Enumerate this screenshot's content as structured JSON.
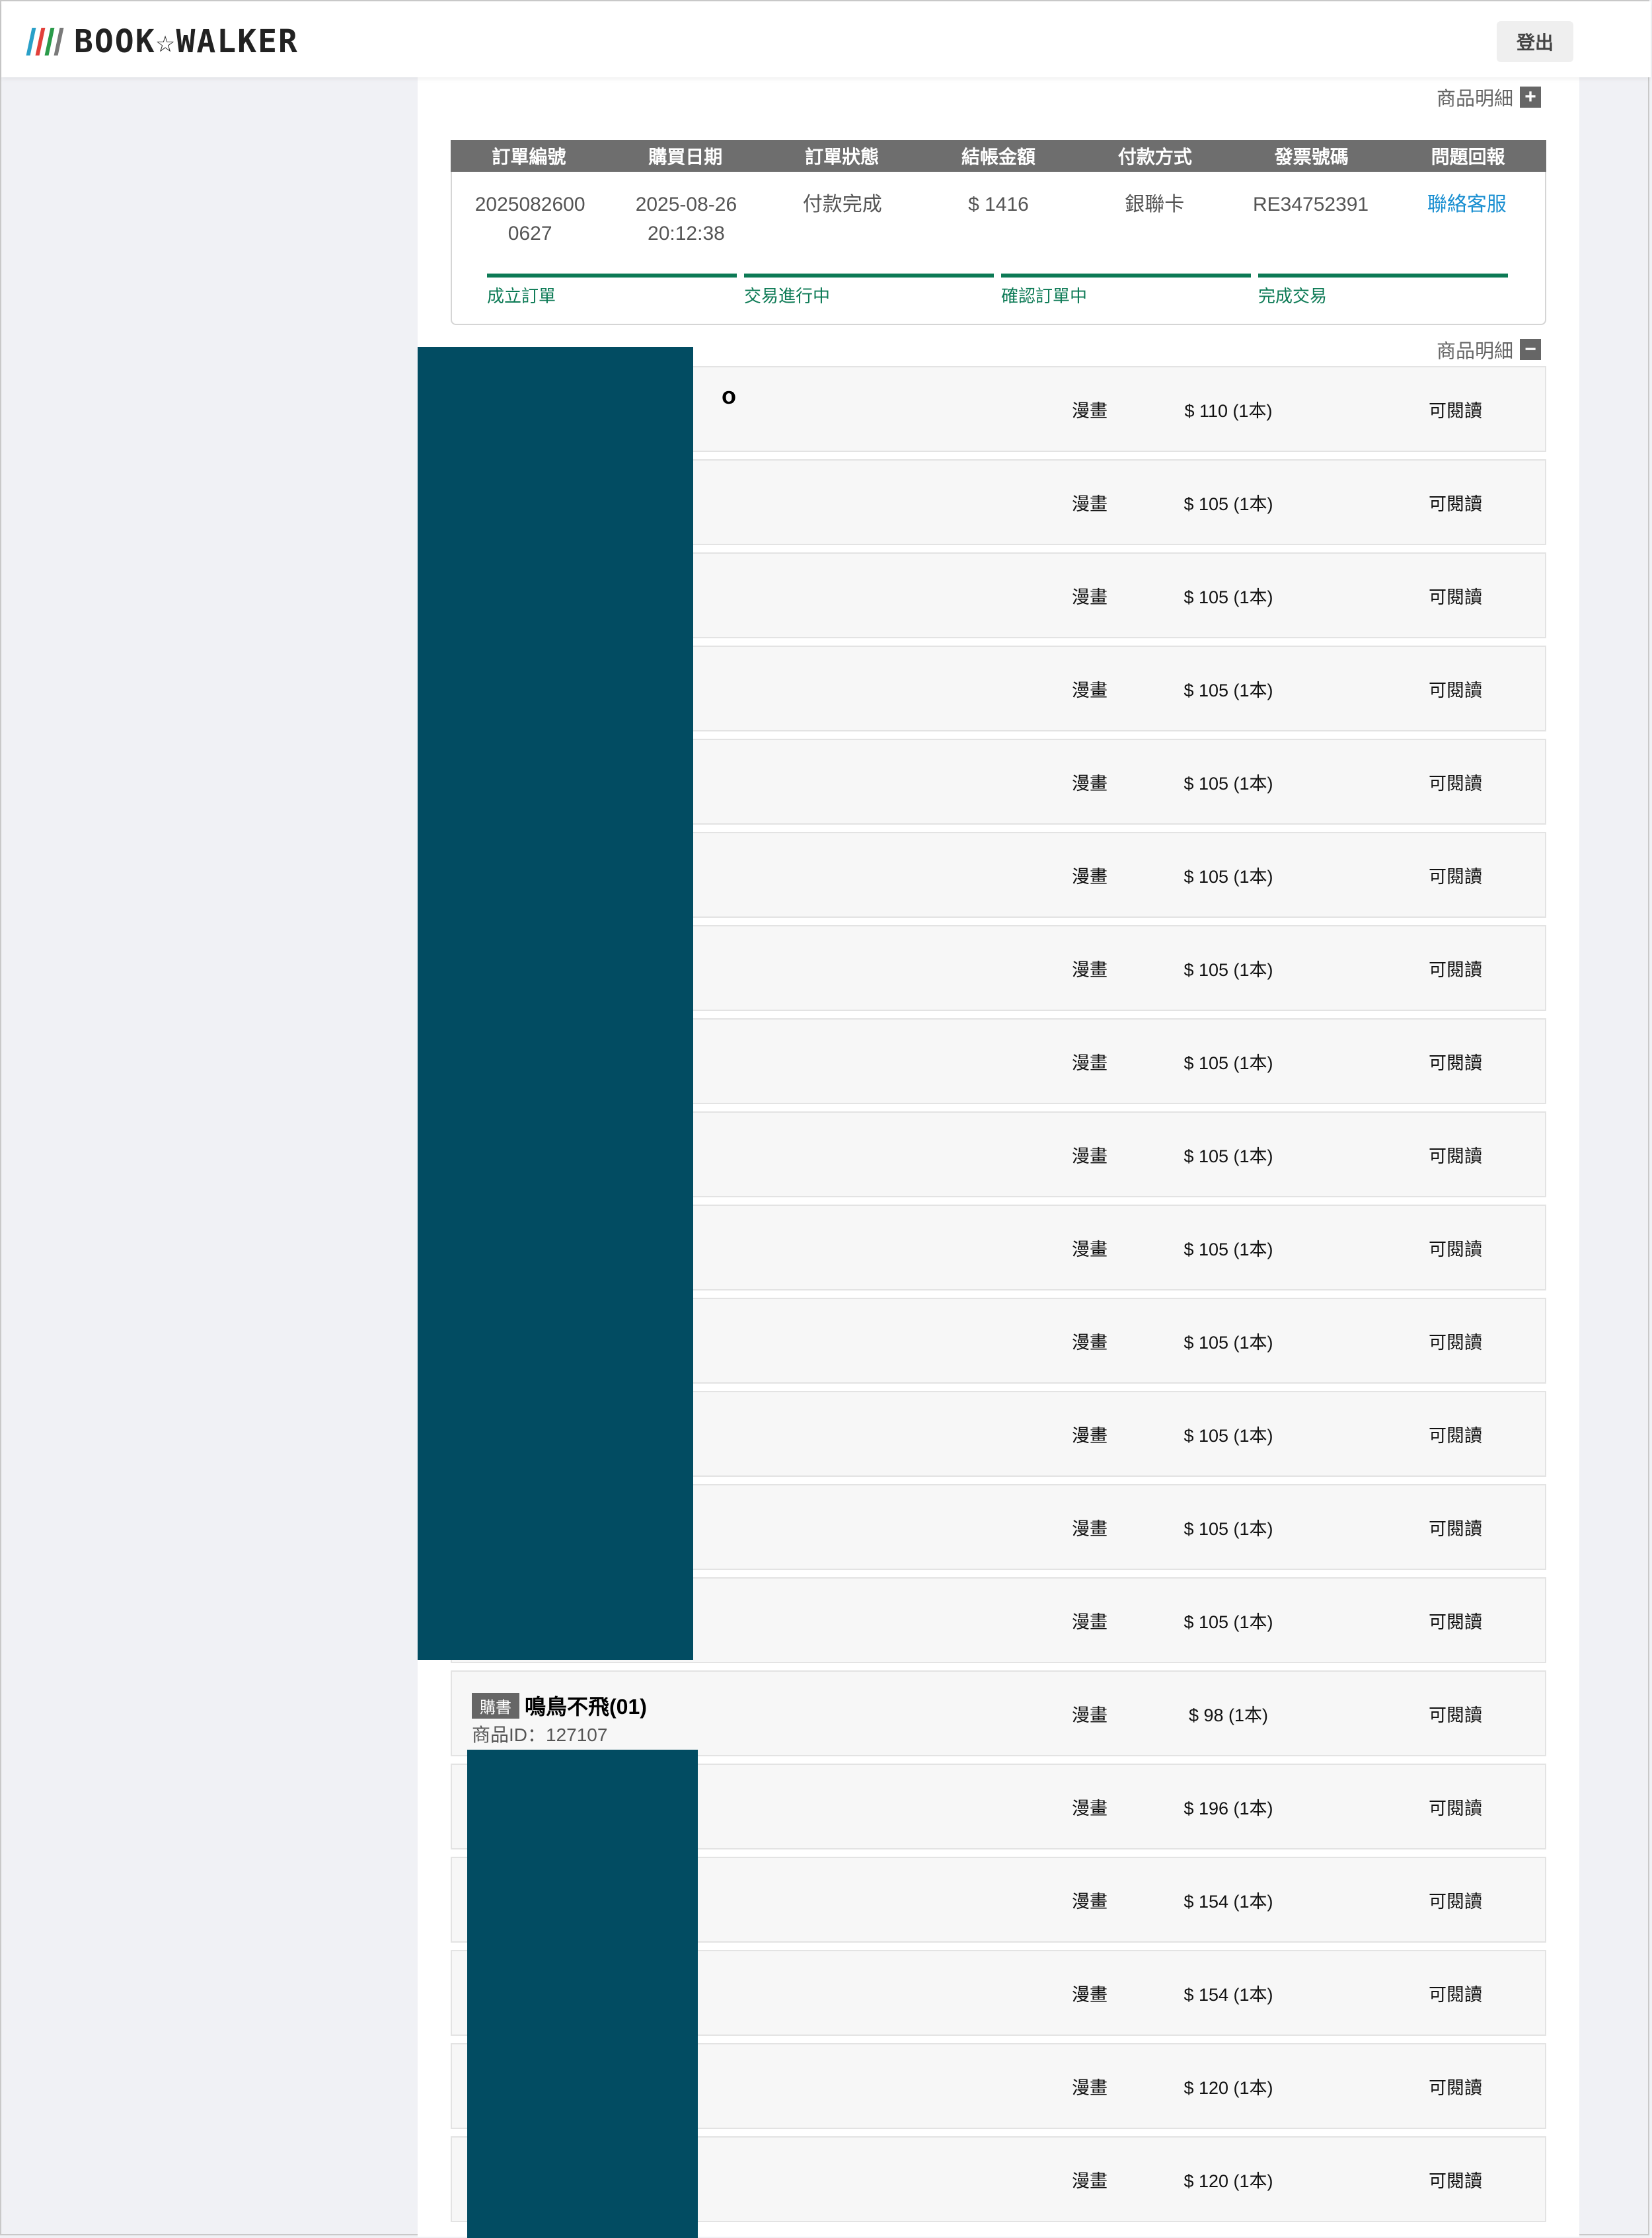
{
  "colors": {
    "page_bg": "#f0f1f5",
    "redaction": "#024c62",
    "progress_green": "#0c7a55",
    "link_blue": "#1a8fd1",
    "table_head": "#6e6e6e"
  },
  "header": {
    "logo_text": "BOOK☆WALKER",
    "logo_bar_colors": [
      "#2aa0c8",
      "#e2403a",
      "#2b9b4a",
      "#7a7a7a"
    ],
    "logout_label": "登出"
  },
  "order": {
    "detail_toggle_label": "商品明細",
    "detail_toggle_icon": "plus-icon",
    "columns": [
      "訂單編號",
      "購買日期",
      "訂單狀態",
      "結帳金額",
      "付款方式",
      "發票號碼",
      "問題回報"
    ],
    "values": {
      "order_no": "2025082600\n0627",
      "date": "2025-08-26\n20:12:38",
      "status": "付款完成",
      "amount": "$ 1416",
      "payment": "銀聯卡",
      "invoice": "RE34752391",
      "report_link": "聯絡客服"
    },
    "progress_steps": [
      "成立訂單",
      "交易進行中",
      "確認訂單中",
      "完成交易"
    ]
  },
  "items_section": {
    "detail_toggle_label": "商品明細",
    "detail_toggle_icon": "minus-icon",
    "partial_glyph": "o",
    "items": [
      {
        "category": "漫畫",
        "price": "$ 110 (1本)",
        "status": "可閱讀"
      },
      {
        "category": "漫畫",
        "price": "$ 105 (1本)",
        "status": "可閱讀"
      },
      {
        "category": "漫畫",
        "price": "$ 105 (1本)",
        "status": "可閱讀"
      },
      {
        "category": "漫畫",
        "price": "$ 105 (1本)",
        "status": "可閱讀"
      },
      {
        "category": "漫畫",
        "price": "$ 105 (1本)",
        "status": "可閱讀"
      },
      {
        "category": "漫畫",
        "price": "$ 105 (1本)",
        "status": "可閱讀"
      },
      {
        "category": "漫畫",
        "price": "$ 105 (1本)",
        "status": "可閱讀"
      },
      {
        "category": "漫畫",
        "price": "$ 105 (1本)",
        "status": "可閱讀"
      },
      {
        "category": "漫畫",
        "price": "$ 105 (1本)",
        "status": "可閱讀"
      },
      {
        "category": "漫畫",
        "price": "$ 105 (1本)",
        "status": "可閱讀"
      },
      {
        "category": "漫畫",
        "price": "$ 105 (1本)",
        "status": "可閱讀"
      },
      {
        "category": "漫畫",
        "price": "$ 105 (1本)",
        "status": "可閱讀"
      },
      {
        "category": "漫畫",
        "price": "$ 105 (1本)",
        "status": "可閱讀"
      },
      {
        "category": "漫畫",
        "price": "$ 105 (1本)",
        "status": "可閱讀"
      },
      {
        "category": "漫畫",
        "price": "$ 98 (1本)",
        "status": "可閱讀",
        "badge": "購書",
        "title": "鳴鳥不飛(01)",
        "product_id": "商品ID：127107"
      },
      {
        "category": "漫畫",
        "price": "$ 196 (1本)",
        "status": "可閱讀"
      },
      {
        "category": "漫畫",
        "price": "$ 154 (1本)",
        "status": "可閱讀"
      },
      {
        "category": "漫畫",
        "price": "$ 154 (1本)",
        "status": "可閱讀"
      },
      {
        "category": "漫畫",
        "price": "$ 120 (1本)",
        "status": "可閱讀"
      },
      {
        "category": "漫畫",
        "price": "$ 120 (1本)",
        "status": "可閱讀"
      }
    ]
  }
}
